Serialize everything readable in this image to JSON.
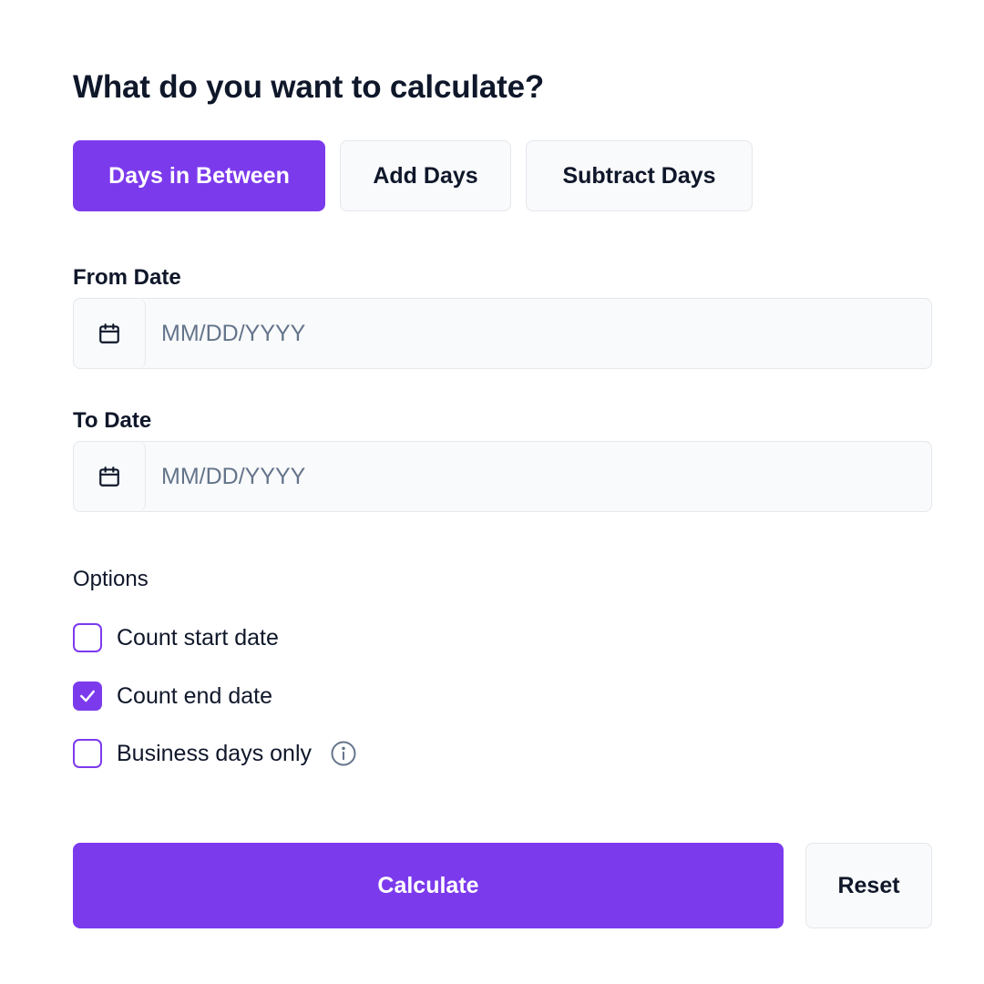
{
  "page": {
    "title": "What do you want to calculate?"
  },
  "tabs": [
    {
      "label": "Days in Between",
      "active": true
    },
    {
      "label": "Add Days",
      "active": false
    },
    {
      "label": "Subtract Days",
      "active": false
    }
  ],
  "from_date": {
    "label": "From Date",
    "value": "",
    "placeholder": "MM/DD/YYYY",
    "icon": "calendar-icon"
  },
  "to_date": {
    "label": "To Date",
    "value": "",
    "placeholder": "MM/DD/YYYY",
    "icon": "calendar-icon"
  },
  "options": {
    "title": "Options",
    "items": [
      {
        "label": "Count start date",
        "checked": false
      },
      {
        "label": "Count end date",
        "checked": true
      },
      {
        "label": "Business days only",
        "checked": false,
        "icon": "info-icon"
      }
    ]
  },
  "actions": {
    "calculate_label": "Calculate",
    "reset_label": "Reset"
  },
  "colors": {
    "accent": "#7c3aed",
    "text": "#0f172a",
    "placeholder": "#64748b",
    "border": "#e5e7eb",
    "surface": "#f9fafb"
  }
}
